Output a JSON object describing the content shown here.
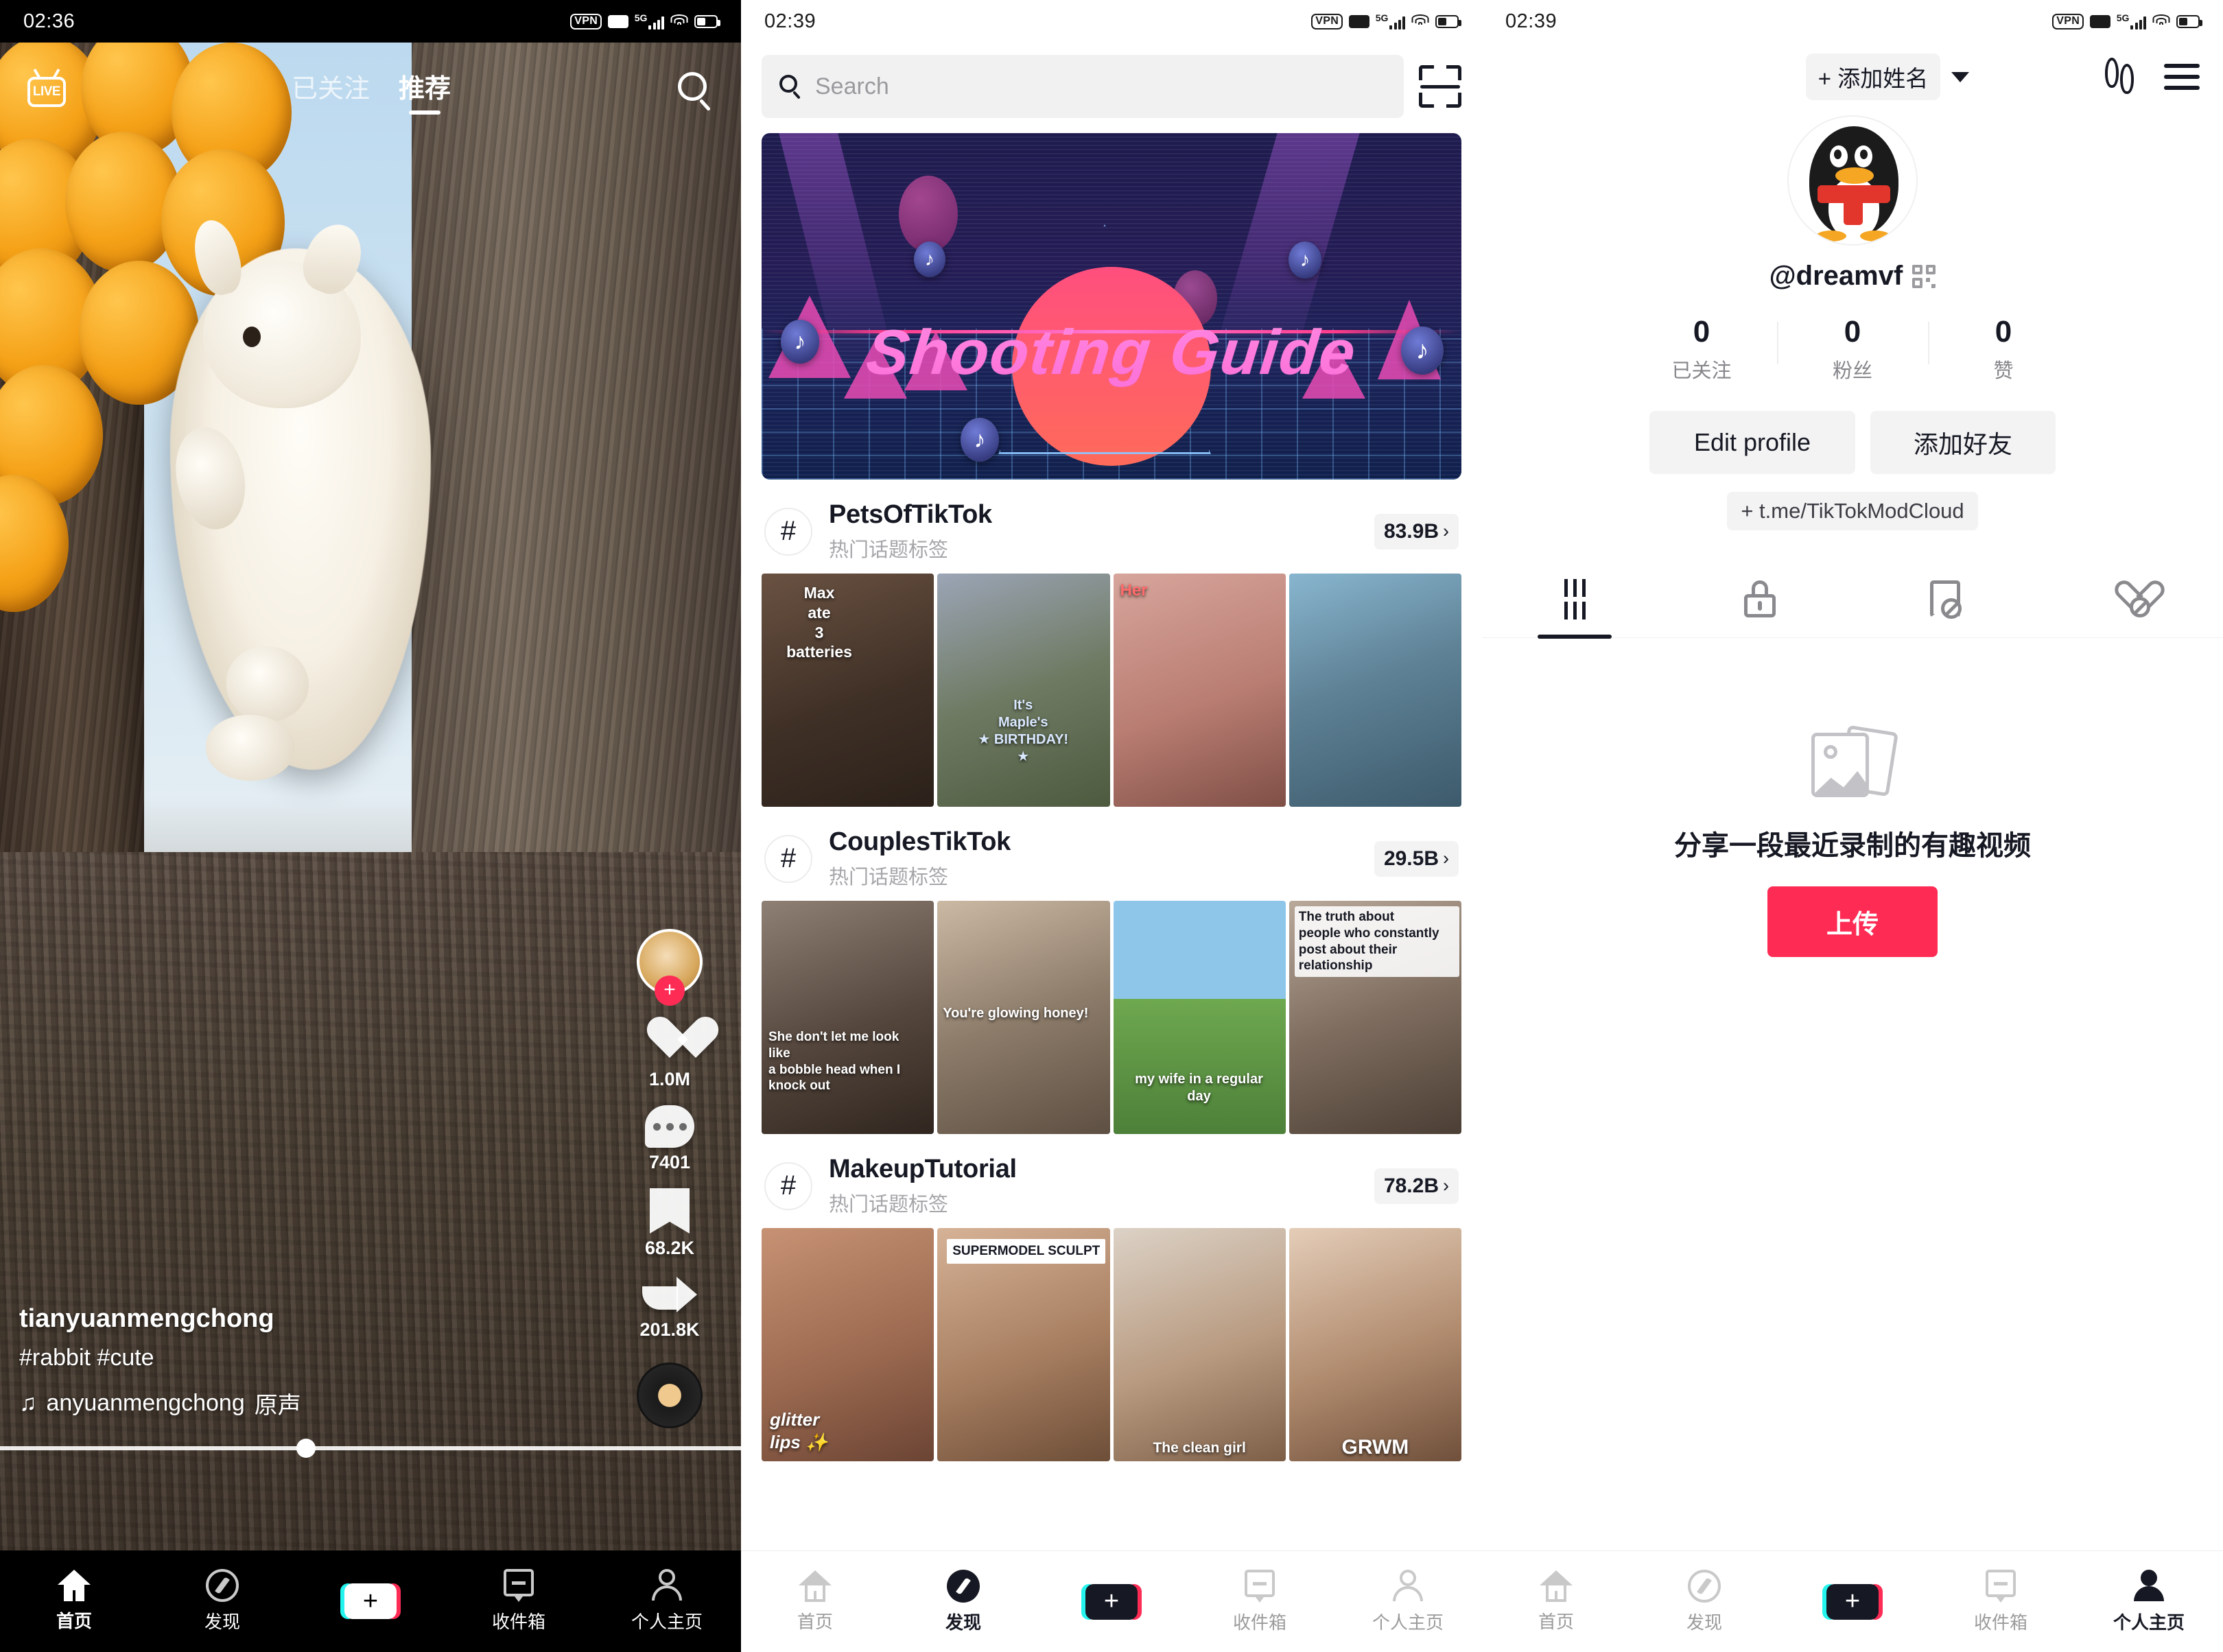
{
  "panel1": {
    "status": {
      "time": "02:36",
      "vpn": "VPN",
      "hd": "HD",
      "net": "5G"
    },
    "top": {
      "live_label": "LIVE",
      "tab_following": "已关注",
      "tab_foryou": "推荐",
      "search_icon": "search-icon"
    },
    "rail": {
      "avatar_plus": "+",
      "likes": "1.0M",
      "comments": "7401",
      "bookmarks": "68.2K",
      "shares": "201.8K"
    },
    "caption": {
      "username": "tianyuanmengchong",
      "hashtags": "#rabbit #cute",
      "music_note": "♫",
      "music": "anyuanmengchong",
      "music_suffix": "原声"
    },
    "nav": [
      {
        "label": "首页",
        "icon": "home-icon",
        "active": true
      },
      {
        "label": "发现",
        "icon": "compass-icon",
        "active": false
      },
      {
        "label": "",
        "icon": "create-plus-icon",
        "active": false
      },
      {
        "label": "收件箱",
        "icon": "inbox-icon",
        "active": false
      },
      {
        "label": "个人主页",
        "icon": "profile-icon",
        "active": false
      }
    ]
  },
  "panel2": {
    "status": {
      "time": "02:39",
      "vpn": "VPN",
      "hd": "HD",
      "net": "5G"
    },
    "search": {
      "placeholder": "Search",
      "value": "",
      "scan_icon": "scan-icon"
    },
    "banner": {
      "title": "Shooting Guide",
      "tiktok_note": "♪"
    },
    "hashtags": [
      {
        "name": "PetsOfTikTok",
        "subtitle": "热门话题标签",
        "count": "83.9B",
        "chevron": "›",
        "videos": [
          {
            "caption": "Max\nate\n3\nbatteries"
          },
          {
            "caption": "It's\nMaple's\n★ BIRTHDAY! ★"
          },
          {
            "caption": "Her"
          },
          {
            "caption": ""
          }
        ]
      },
      {
        "name": "CouplesTikTok",
        "subtitle": "热门话题标签",
        "count": "29.5B",
        "chevron": "›",
        "videos": [
          {
            "caption": "She don't let me look like\na bobble head when I\nknock out"
          },
          {
            "caption": "You're glowing honey!"
          },
          {
            "caption": "my wife in a regular\nday"
          },
          {
            "caption": "The truth about\npeople who constantly\npost about their\nrelationship"
          }
        ]
      },
      {
        "name": "MakeupTutorial",
        "subtitle": "热门话题标签",
        "count": "78.2B",
        "chevron": "›",
        "videos": [
          {
            "caption": "glitter\nlips ✨"
          },
          {
            "caption": "SUPERMODEL SCULPT"
          },
          {
            "caption": "The clean girl"
          },
          {
            "caption": "GRWM"
          }
        ]
      }
    ],
    "nav": [
      {
        "label": "首页",
        "icon": "home-icon",
        "active": false
      },
      {
        "label": "发现",
        "icon": "compass-icon",
        "active": true
      },
      {
        "label": "",
        "icon": "create-plus-icon",
        "active": false
      },
      {
        "label": "收件箱",
        "icon": "inbox-icon",
        "active": false
      },
      {
        "label": "个人主页",
        "icon": "profile-icon",
        "active": false
      }
    ]
  },
  "panel3": {
    "status": {
      "time": "02:39",
      "vpn": "VPN",
      "hd": "HD",
      "net": "5G"
    },
    "top": {
      "add_name": "+ 添加姓名",
      "footprints_icon": "footprints-icon",
      "menu_icon": "hamburger-menu-icon"
    },
    "profile": {
      "avatar_icon": "qq-penguin-avatar",
      "handle": "@dreamvf",
      "qr_icon": "qr-code-icon",
      "stats": [
        {
          "value": "0",
          "label": "已关注"
        },
        {
          "value": "0",
          "label": "粉丝"
        },
        {
          "value": "0",
          "label": "赞"
        }
      ],
      "edit_button": "Edit profile",
      "add_friend_button": "添加好友",
      "bio": "+ t.me/TikTokModCloud"
    },
    "tabs": [
      {
        "icon": "grid-icon",
        "active": true
      },
      {
        "icon": "lock-icon",
        "active": false
      },
      {
        "icon": "bookmark-hidden-icon",
        "active": false
      },
      {
        "icon": "heart-hidden-icon",
        "active": false
      }
    ],
    "empty": {
      "icon": "photos-placeholder-icon",
      "message": "分享一段最近录制的有趣视频",
      "upload_button": "上传"
    },
    "nav": [
      {
        "label": "首页",
        "icon": "home-icon",
        "active": false
      },
      {
        "label": "发现",
        "icon": "compass-icon",
        "active": false
      },
      {
        "label": "",
        "icon": "create-plus-icon",
        "active": false
      },
      {
        "label": "收件箱",
        "icon": "inbox-icon",
        "active": false
      },
      {
        "label": "个人主页",
        "icon": "profile-icon",
        "active": true
      }
    ]
  },
  "colors": {
    "accent_red": "#fe2c55",
    "accent_cyan": "#25f4ee",
    "text": "#161823",
    "muted": "#86868b"
  }
}
